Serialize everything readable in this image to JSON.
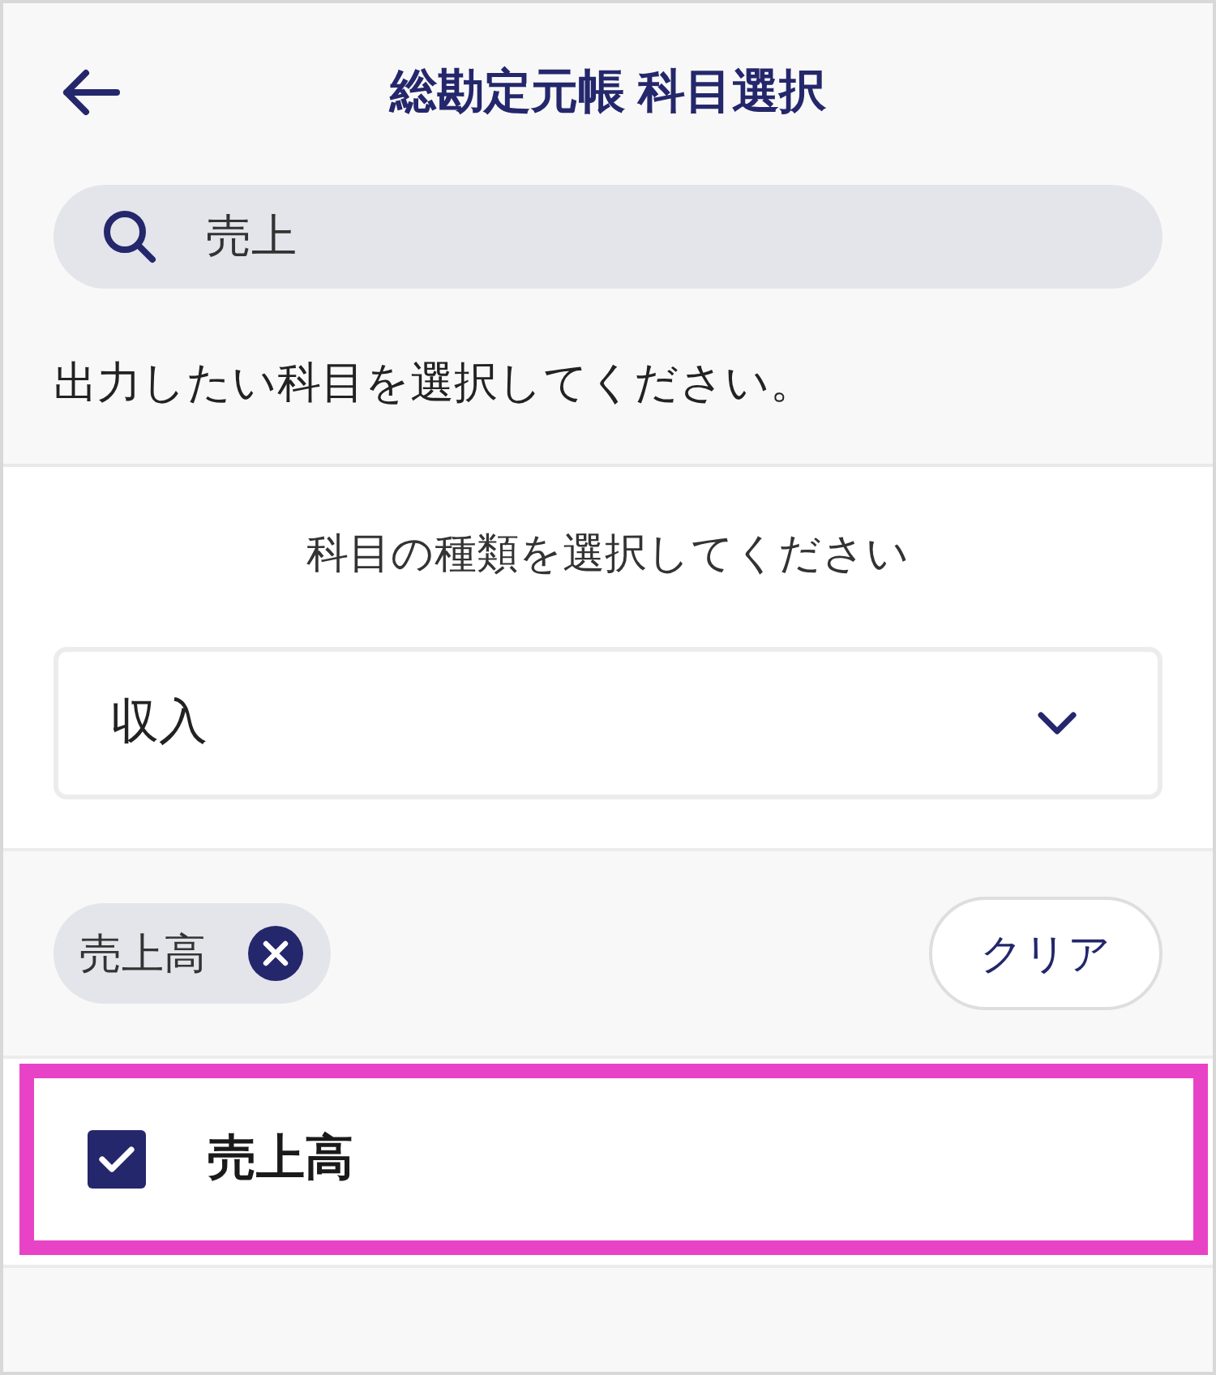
{
  "header": {
    "title": "総勘定元帳 科目選択"
  },
  "search": {
    "value": "売上"
  },
  "instruction": "出力したい科目を選択してください。",
  "category": {
    "label": "科目の種類を選択してください",
    "value": "収入"
  },
  "selected_chips": [
    {
      "label": "売上高"
    }
  ],
  "clear_button": "クリア",
  "results": [
    {
      "label": "売上高",
      "checked": true,
      "highlighted": true
    }
  ]
}
